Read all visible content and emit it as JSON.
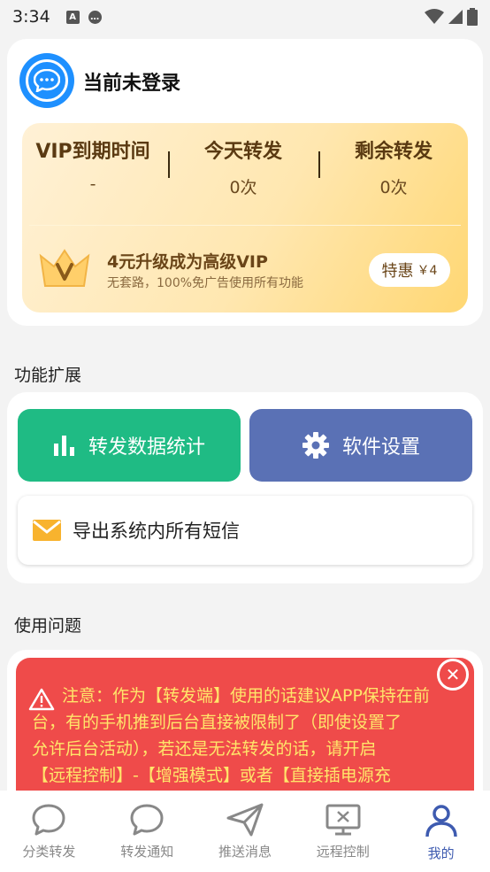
{
  "status_bar": {
    "time": "3:34"
  },
  "user": {
    "login_status": "当前未登录"
  },
  "vip": {
    "stats": [
      {
        "label": "VIP到期时间",
        "value": "-"
      },
      {
        "label": "今天转发",
        "value": "0次"
      },
      {
        "label": "剩余转发",
        "value": "0次"
      }
    ],
    "upgrade_title": "4元升级成为高级VIP",
    "upgrade_subtitle": "无套路，100%免广告使用所有功能",
    "special_label": "特惠",
    "special_price": "￥4",
    "accent_color": "#ffd773"
  },
  "sections": {
    "functions": "功能扩展",
    "usage": "使用问题"
  },
  "functions": {
    "stats_label": "转发数据统计",
    "settings_label": "软件设置",
    "export_label": "导出系统内所有短信"
  },
  "notice": {
    "lines": [
      "注意：作为【转发端】使用的话建议APP保持在前",
      "台，有的手机推到后台直接被限制了（即使设置了",
      "允许后台活动），若还是无法转发的话，请开启",
      "【远程控制】-【增强模式】或者【直接插电源充"
    ],
    "color": "#ef4b4a"
  },
  "nav": [
    {
      "label": "分类转发",
      "icon": "chat-bubble-icon"
    },
    {
      "label": "转发通知",
      "icon": "chat-bubble-icon"
    },
    {
      "label": "推送消息",
      "icon": "send-icon"
    },
    {
      "label": "远程控制",
      "icon": "remote-screen-icon"
    },
    {
      "label": "我的",
      "icon": "user-icon",
      "active": true
    }
  ]
}
